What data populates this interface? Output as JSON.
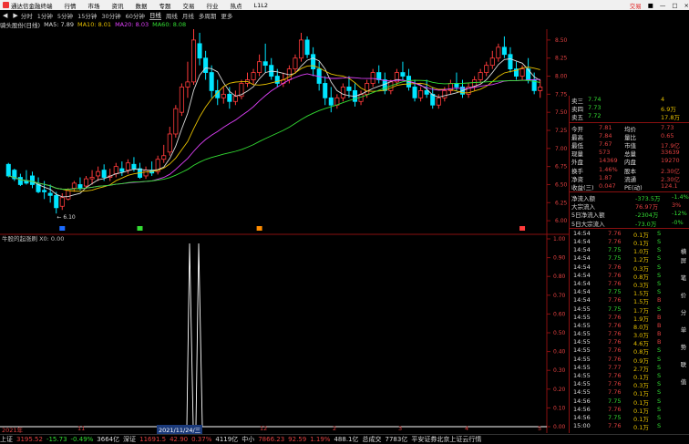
{
  "menu": {
    "app_title": "通达信金融终端",
    "items": [
      "行情",
      "市场",
      "资讯",
      "数据",
      "专题",
      "交易",
      "行业",
      "热点",
      "L1L2"
    ],
    "right_items": [
      "交易",
      "■",
      "—",
      "□",
      "×"
    ]
  },
  "toolbar": {
    "periods": [
      "分时",
      "1分钟",
      "5分钟",
      "15分钟",
      "30分钟",
      "60分钟",
      "日线",
      "周线",
      "月线",
      "多周期",
      "更多"
    ],
    "selected": "日线"
  },
  "ma_line": {
    "stock": "骑头股份(日线)",
    "ma5": "MA5: 7.89",
    "ma10": "MA10: 8.01",
    "ma20": "MA20: 8.03",
    "ma60": "MA60: 8.08"
  },
  "chart_data": {
    "type": "candlestick",
    "ylim": [
      5.85,
      8.65
    ],
    "yticks": [
      "8.50",
      "8.25",
      "8.00",
      "7.75",
      "7.50",
      "7.25",
      "7.00",
      "6.75",
      "6.50",
      "6.25",
      "6.00"
    ],
    "low_label": "6.10",
    "candles": [
      [
        6.78,
        6.8,
        6.62,
        6.6
      ],
      [
        6.7,
        6.72,
        6.58,
        6.55
      ],
      [
        6.6,
        6.65,
        6.5,
        6.48
      ],
      [
        6.55,
        6.7,
        6.52,
        6.5
      ],
      [
        6.62,
        6.68,
        6.5,
        6.45
      ],
      [
        6.5,
        6.6,
        6.4,
        6.38
      ],
      [
        6.42,
        6.55,
        6.4,
        6.3
      ],
      [
        6.38,
        6.5,
        6.35,
        6.25
      ],
      [
        6.35,
        6.4,
        6.18,
        6.1
      ],
      [
        6.2,
        6.38,
        6.32,
        6.15
      ],
      [
        6.3,
        6.45,
        6.42,
        6.28
      ],
      [
        6.45,
        6.55,
        6.52,
        6.4
      ],
      [
        6.5,
        6.6,
        6.45,
        6.42
      ],
      [
        6.48,
        6.62,
        6.58,
        6.44
      ],
      [
        6.58,
        6.7,
        6.6,
        6.5
      ],
      [
        6.62,
        6.75,
        6.68,
        6.55
      ],
      [
        6.7,
        6.78,
        6.6,
        6.55
      ],
      [
        6.6,
        6.72,
        6.62,
        6.55
      ],
      [
        6.65,
        6.8,
        6.75,
        6.6
      ],
      [
        6.72,
        6.82,
        6.68,
        6.62
      ],
      [
        6.7,
        6.85,
        6.8,
        6.65
      ],
      [
        6.78,
        6.88,
        6.72,
        6.68
      ],
      [
        6.72,
        6.8,
        6.6,
        6.58
      ],
      [
        6.62,
        6.75,
        6.7,
        6.58
      ],
      [
        6.7,
        6.82,
        6.66,
        6.62
      ],
      [
        6.68,
        6.9,
        6.85,
        6.64
      ],
      [
        6.85,
        7.05,
        6.9,
        6.8
      ],
      [
        6.95,
        7.3,
        7.2,
        6.9
      ],
      [
        7.2,
        7.6,
        7.55,
        7.15
      ],
      [
        7.5,
        7.9,
        7.85,
        7.45
      ],
      [
        7.85,
        8.2,
        7.92,
        7.7
      ],
      [
        7.92,
        8.7,
        8.5,
        7.88
      ],
      [
        8.45,
        8.6,
        8.25,
        8.15
      ],
      [
        8.25,
        8.35,
        8.05,
        7.95
      ],
      [
        8.05,
        8.15,
        7.8,
        7.7
      ],
      [
        7.8,
        7.95,
        7.7,
        7.6
      ],
      [
        7.7,
        7.85,
        7.75,
        7.62
      ],
      [
        7.75,
        7.85,
        7.65,
        7.55
      ],
      [
        7.65,
        7.8,
        7.72,
        7.6
      ],
      [
        7.72,
        7.95,
        7.9,
        7.68
      ],
      [
        7.9,
        8.05,
        7.95,
        7.85
      ],
      [
        7.95,
        8.1,
        8.05,
        7.88
      ],
      [
        8.05,
        8.3,
        8.2,
        8.0
      ],
      [
        8.2,
        8.45,
        8.15,
        8.05
      ],
      [
        8.15,
        8.25,
        8.0,
        7.95
      ],
      [
        8.0,
        8.1,
        7.9,
        7.85
      ],
      [
        7.9,
        8.05,
        7.95,
        7.85
      ],
      [
        7.95,
        8.15,
        8.1,
        7.9
      ],
      [
        8.1,
        8.3,
        8.25,
        8.05
      ],
      [
        8.25,
        8.6,
        8.5,
        8.2
      ],
      [
        8.5,
        8.55,
        8.3,
        8.25
      ],
      [
        8.3,
        8.4,
        8.1,
        8.0
      ],
      [
        8.1,
        8.2,
        7.9,
        7.8
      ],
      [
        7.9,
        8.0,
        7.7,
        7.6
      ],
      [
        7.7,
        7.85,
        7.6,
        7.5
      ],
      [
        7.6,
        7.75,
        7.7,
        7.55
      ],
      [
        7.7,
        7.9,
        7.85,
        7.65
      ],
      [
        7.85,
        8.0,
        7.8,
        7.7
      ],
      [
        7.8,
        7.9,
        7.65,
        7.58
      ],
      [
        7.65,
        7.8,
        7.75,
        7.6
      ],
      [
        7.75,
        7.95,
        7.9,
        7.7
      ],
      [
        7.9,
        8.1,
        8.05,
        7.85
      ],
      [
        8.05,
        8.15,
        7.95,
        7.9
      ],
      [
        7.95,
        8.05,
        7.8,
        7.75
      ],
      [
        7.8,
        7.95,
        7.92,
        7.75
      ],
      [
        7.92,
        8.1,
        8.05,
        7.88
      ],
      [
        8.05,
        8.2,
        8.0,
        7.95
      ],
      [
        8.0,
        8.1,
        7.85,
        7.8
      ],
      [
        7.85,
        7.95,
        7.7,
        7.65
      ],
      [
        7.7,
        7.85,
        7.8,
        7.65
      ],
      [
        7.8,
        7.95,
        7.75,
        7.7
      ],
      [
        7.75,
        7.85,
        7.6,
        7.55
      ],
      [
        7.6,
        7.75,
        7.7,
        7.55
      ],
      [
        7.7,
        7.85,
        7.8,
        7.65
      ],
      [
        7.8,
        7.95,
        7.9,
        7.75
      ],
      [
        7.9,
        8.05,
        7.85,
        7.8
      ],
      [
        7.85,
        7.95,
        7.75,
        7.7
      ],
      [
        7.75,
        7.9,
        7.85,
        7.7
      ],
      [
        7.85,
        8.0,
        7.95,
        7.8
      ],
      [
        7.95,
        8.1,
        8.05,
        7.9
      ],
      [
        8.05,
        8.2,
        8.15,
        8.0
      ],
      [
        8.15,
        8.35,
        8.25,
        8.1
      ],
      [
        8.25,
        8.45,
        8.4,
        8.2
      ],
      [
        8.4,
        8.55,
        8.3,
        8.25
      ],
      [
        8.3,
        8.4,
        8.1,
        8.05
      ],
      [
        8.1,
        8.2,
        8.0,
        7.95
      ],
      [
        8.0,
        8.15,
        8.1,
        7.95
      ],
      [
        8.1,
        8.25,
        7.95,
        7.9
      ],
      [
        7.95,
        8.05,
        7.8,
        7.75
      ],
      [
        7.8,
        7.95,
        7.85,
        7.7
      ]
    ],
    "ma_colors": {
      "ma5": "#dcdcdc",
      "ma10": "#e6c000",
      "ma20": "#e040fb",
      "ma60": "#33dd33"
    }
  },
  "indicator": {
    "title": "牛股的起涨刷 X0: 0.00",
    "yticks": [
      "1.00",
      "0.90",
      "0.80",
      "0.70",
      "0.60",
      "0.50",
      "0.40",
      "0.30",
      "0.20",
      "0.10",
      "0.00"
    ]
  },
  "date_axis": {
    "labels": [
      "2021年",
      "11",
      "2021/11/24/三",
      "12",
      "2",
      "3",
      "4",
      "5"
    ],
    "cursor_date": "2021/11/24/三"
  },
  "tabs": {
    "row1": [
      "指标",
      "窗口",
      "MACD",
      "VOL-TDX",
      "CCI",
      "趋势动力",
      "主力监控",
      "私募主图",
      "MA2",
      "测试主图",
      "测试幅图A",
      "测试幅图B",
      "更多",
      "设置"
    ],
    "row2": [
      "扩展A",
      "关联报价",
      "资金分布",
      "综合资讯",
      "行业资讯",
      "互动问答",
      "家用户福利专享"
    ]
  },
  "quote": {
    "asks": [
      [
        "卖三",
        "7.74",
        "4"
      ],
      [
        "卖四",
        "7.73",
        "6.9万"
      ],
      [
        "卖五",
        "7.72",
        "17.8万"
      ]
    ],
    "stats": [
      [
        "今开",
        "7.81",
        "均价",
        "7.73"
      ],
      [
        "最高",
        "7.84",
        "量比",
        "0.65"
      ],
      [
        "最低",
        "7.67",
        "市值",
        "17.9亿"
      ],
      [
        "现量",
        "573",
        "总量",
        "33639"
      ],
      [
        "外盘",
        "14369",
        "内盘",
        "19270"
      ],
      [
        "换手",
        "1.46%",
        "股本",
        "2.30亿"
      ],
      [
        "净资",
        "1.87",
        "流通",
        "2.30亿"
      ],
      [
        "收益(三)",
        "0.047",
        "PE(动)",
        "124.1"
      ]
    ],
    "flow": [
      [
        "净流入额",
        "-373.5万",
        "-1.4%"
      ],
      [
        "大宗流入",
        "76.97万",
        "3%"
      ],
      [
        "5日净流入额",
        "-2304万",
        "-12%"
      ],
      [
        "5日大宗流入",
        "-73.0万",
        "-0%"
      ]
    ]
  },
  "ticks": [
    [
      "14:54",
      "7.76",
      "0.1万",
      "S"
    ],
    [
      "14:54",
      "7.76",
      "0.1万",
      "S"
    ],
    [
      "14:54",
      "7.75",
      "1.0万",
      "S"
    ],
    [
      "14:54",
      "7.75",
      "1.2万",
      "S"
    ],
    [
      "14:54",
      "7.76",
      "0.3万",
      "S"
    ],
    [
      "14:54",
      "7.76",
      "0.8万",
      "S"
    ],
    [
      "14:54",
      "7.76",
      "0.3万",
      "S"
    ],
    [
      "14:54",
      "7.75",
      "1.5万",
      "S"
    ],
    [
      "14:54",
      "7.76",
      "1.5万",
      "B"
    ],
    [
      "14:55",
      "7.75",
      "1.7万",
      "S"
    ],
    [
      "14:55",
      "7.76",
      "1.9万",
      "B"
    ],
    [
      "14:55",
      "7.76",
      "8.0万",
      "B"
    ],
    [
      "14:55",
      "7.76",
      "3.0万",
      "B"
    ],
    [
      "14:55",
      "7.76",
      "4.6万",
      "B"
    ],
    [
      "14:55",
      "7.76",
      "0.8万",
      "S"
    ],
    [
      "14:55",
      "7.76",
      "0.9万",
      "S"
    ],
    [
      "14:55",
      "7.77",
      "2.7万",
      "S"
    ],
    [
      "14:55",
      "7.76",
      "0.1万",
      "S"
    ],
    [
      "14:55",
      "7.76",
      "0.3万",
      "S"
    ],
    [
      "14:55",
      "7.76",
      "0.1万",
      "S"
    ],
    [
      "14:56",
      "7.75",
      "0.1万",
      "S"
    ],
    [
      "14:56",
      "7.76",
      "0.1万",
      "S"
    ],
    [
      "14:56",
      "7.75",
      "0.1万",
      "S"
    ],
    [
      "15:00",
      "7.76",
      "0.1万",
      "S"
    ]
  ],
  "side_tabs": [
    "横屏",
    "笔",
    "价",
    "分",
    "单",
    "势",
    "联",
    "值"
  ],
  "statusbar": {
    "items": [
      {
        "label": "上证",
        "value": "3195.52",
        "chg": "-15.73",
        "pct": "-0.49%",
        "vol": "3664亿"
      },
      {
        "label": "深证",
        "value": "11691.5",
        "chg": "42.90",
        "pct": "0.37%",
        "vol": "4119亿"
      },
      {
        "label": "中小",
        "value": "7866.23",
        "chg": "92.59",
        "pct": "1.19%",
        "vol": "488.1亿"
      },
      {
        "label": "总成交",
        "value": "7783亿"
      }
    ],
    "right_text": "平安证券北京上证云行情"
  },
  "watermark": "www.7gpzb.com"
}
